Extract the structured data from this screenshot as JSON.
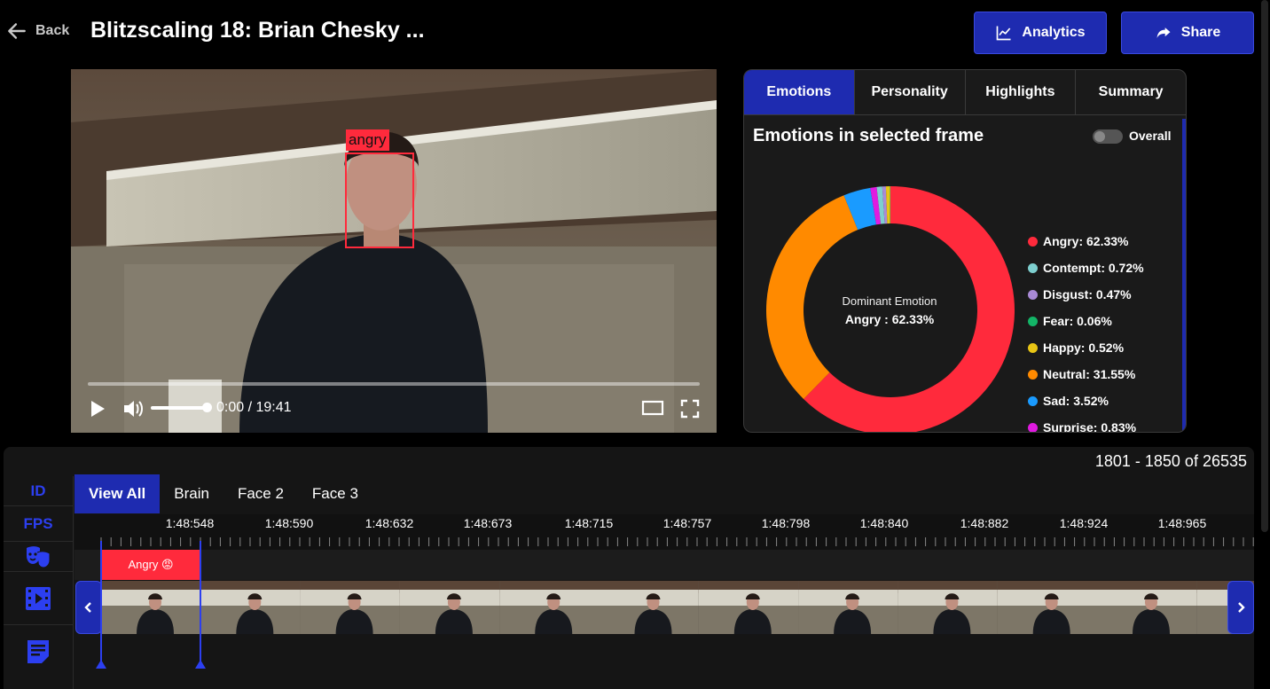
{
  "header": {
    "back_label": "Back",
    "title": "Blitzscaling 18: Brian Chesky ...",
    "analytics_label": "Analytics",
    "share_label": "Share"
  },
  "video": {
    "face_label": "angry",
    "time": "0:00 / 19:41",
    "volume_level": 0.85
  },
  "panel": {
    "tabs": [
      "Emotions",
      "Personality",
      "Highlights",
      "Summary"
    ],
    "active_tab": "Emotions",
    "title": "Emotions in selected frame",
    "toggle_label": "Overall",
    "center_label": "Dominant Emotion",
    "center_value": "Angry : 62.33%"
  },
  "chart_data": {
    "type": "pie",
    "categories": [
      "Angry",
      "Contempt",
      "Disgust",
      "Fear",
      "Happy",
      "Neutral",
      "Sad",
      "Surprise"
    ],
    "values": [
      62.33,
      0.72,
      0.47,
      0.06,
      0.52,
      31.55,
      3.52,
      0.83
    ],
    "legend_labels": [
      "Angry: 62.33%",
      "Contempt: 0.72%",
      "Disgust: 0.47%",
      "Fear: 0.06%",
      "Happy: 0.52%",
      "Neutral: 31.55%",
      "Sad: 3.52%",
      "Surprise: 0.83%"
    ],
    "colors": [
      "#ff2a3c",
      "#7ecfcf",
      "#a98ad6",
      "#13b567",
      "#e8c515",
      "#ff8a00",
      "#1a9bff",
      "#e01ae0"
    ],
    "legend_placement": "right"
  },
  "timeline": {
    "pager": "1801 - 1850 of 26535",
    "side_labels": [
      "ID",
      "FPS"
    ],
    "side_icons": [
      "masks-icon",
      "film-icon",
      "notes-icon"
    ],
    "tabs": [
      "View All",
      "Brain",
      "Face 2",
      "Face 3"
    ],
    "active_tab": "View All",
    "ticks": [
      "1:48:548",
      "1:48:590",
      "1:48:632",
      "1:48:673",
      "1:48:715",
      "1:48:757",
      "1:48:798",
      "1:48:840",
      "1:48:882",
      "1:48:924",
      "1:48:965"
    ],
    "emotion_segment": "Angry 😡"
  },
  "colors": {
    "accent": "#1e2bb0",
    "accent_text": "#2c3ff0",
    "angry": "#ff2a3c"
  }
}
